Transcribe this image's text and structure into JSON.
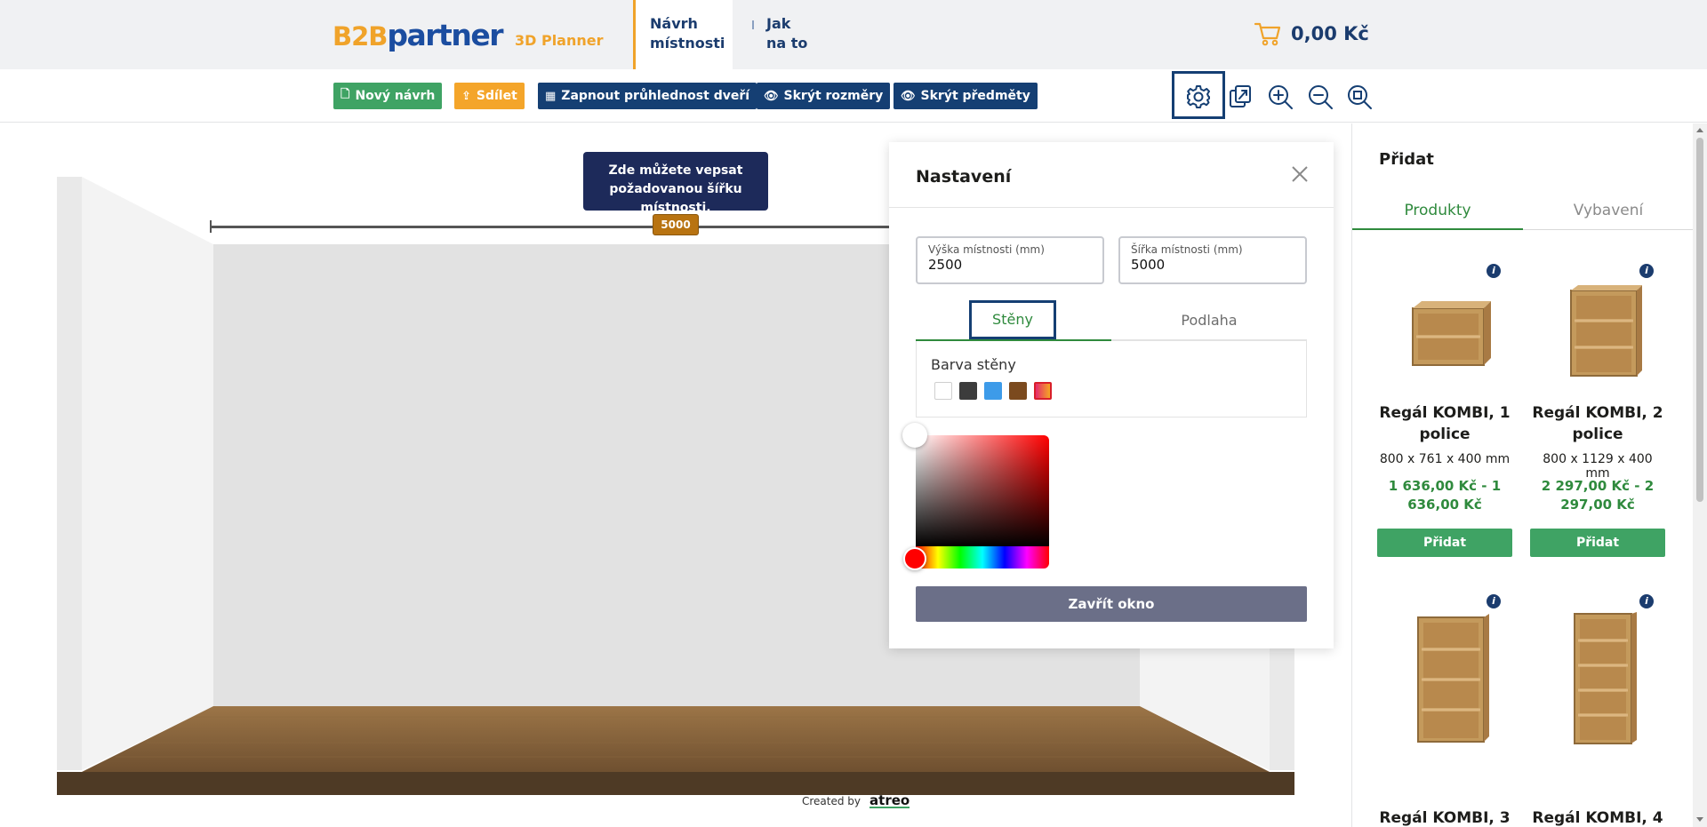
{
  "header": {
    "logo_b2b": "B2B",
    "logo_partner": "partner",
    "logo_planner": "3D Planner",
    "nav": [
      {
        "line1": "Návrh",
        "line2": "místnosti"
      },
      {
        "line1": "Jak",
        "line2": "na to"
      }
    ],
    "cart_total": "0,00 Kč"
  },
  "toolbar": {
    "new_design": "Nový návrh",
    "share": "Sdílet",
    "door_transparency": "Zapnout průhlednost dveří",
    "hide_dimensions": "Skrýt rozměry",
    "hide_objects": "Skrýt předměty",
    "icons": [
      "gear-icon",
      "export-icon",
      "zoom-in-icon",
      "zoom-out-icon",
      "zoom-fit-icon"
    ]
  },
  "canvas": {
    "tooltip": "Zde můžete vepsat požadovanou šířku místnosti.",
    "width_badge": "5000",
    "credit_label": "Created by",
    "credit_brand": "atreo"
  },
  "settings": {
    "title": "Nastavení",
    "height_label": "Výška místnosti (mm)",
    "height_value": "2500",
    "width_label": "Šířka místnosti (mm)",
    "width_value": "5000",
    "tab_walls": "Stěny",
    "tab_floor": "Podlaha",
    "wall_color_label": "Barva stěny",
    "swatches": [
      "#ffffff",
      "#3c3c3c",
      "#3d9be9",
      "#7b4a1e",
      "gradient"
    ],
    "close_button": "Zavřít okno"
  },
  "sidebar": {
    "title": "Přidat",
    "tab_products": "Produkty",
    "tab_equipment": "Vybavení",
    "products": [
      {
        "name": "Regál KOMBI, 1 police",
        "dims": "800 x 761 x 400 mm",
        "price": "1 636,00 Kč - 1 636,00 Kč",
        "add": "Přidat",
        "shelves": 1
      },
      {
        "name": "Regál KOMBI, 2 police",
        "dims": "800 x 1129 x 400 mm",
        "price": "2 297,00 Kč - 2 297,00 Kč",
        "add": "Přidat",
        "shelves": 2
      },
      {
        "name": "Regál KOMBI, 3",
        "shelves": 3
      },
      {
        "name": "Regál KOMBI, 4",
        "shelves": 4
      }
    ]
  },
  "colors": {
    "brand_blue": "#153f73",
    "brand_orange": "#f4a52a",
    "green": "#3fa364",
    "price_green": "#2f8a3d"
  }
}
